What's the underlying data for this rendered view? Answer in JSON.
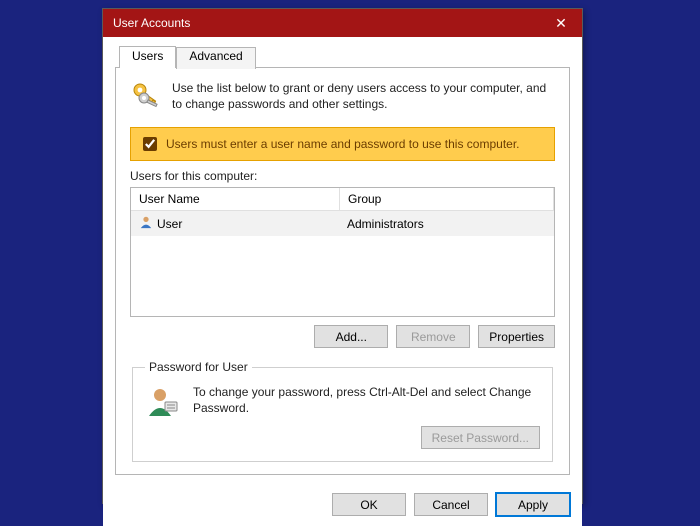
{
  "titlebar": {
    "title": "User Accounts",
    "close_glyph": "✕"
  },
  "tabs": {
    "users": "Users",
    "advanced": "Advanced"
  },
  "intro": "Use the list below to grant or deny users access to your computer, and to change passwords and other settings.",
  "checkbox": {
    "checked": true,
    "label": "Users must enter a user name and password to use this computer."
  },
  "list": {
    "caption": "Users for this computer:",
    "columns": {
      "name": "User Name",
      "group": "Group"
    },
    "row": {
      "name": "User",
      "group": "Administrators"
    }
  },
  "buttons": {
    "add": "Add...",
    "remove": "Remove",
    "properties": "Properties"
  },
  "password_box": {
    "legend": "Password for User",
    "text": "To change your password, press Ctrl-Alt-Del and select Change Password.",
    "reset": "Reset Password..."
  },
  "dialog_buttons": {
    "ok": "OK",
    "cancel": "Cancel",
    "apply": "Apply"
  }
}
